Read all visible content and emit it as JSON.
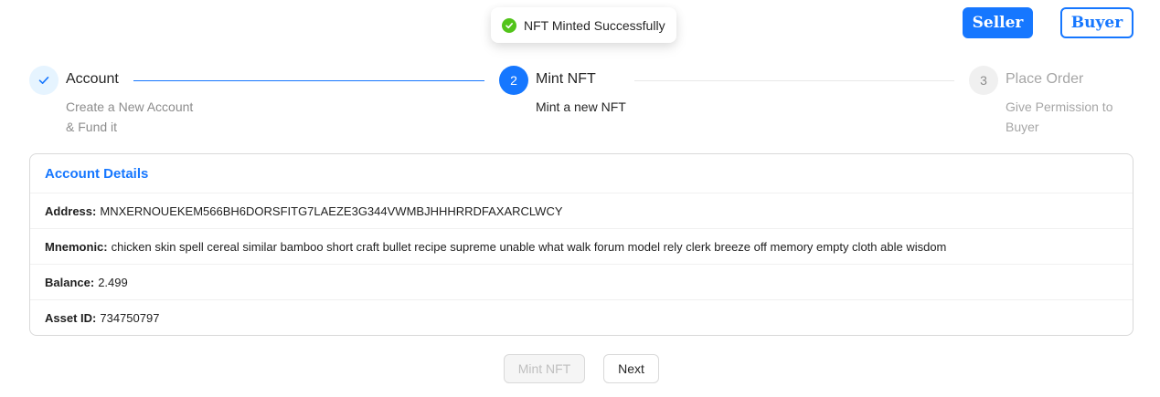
{
  "toast": {
    "message": "NFT Minted Successfully",
    "status_color": "#52c41a"
  },
  "header": {
    "seller_label": "Seller",
    "buyer_label": "Buyer",
    "accent_color": "#1677ff"
  },
  "steps": [
    {
      "number": "1",
      "title": "Account",
      "description": "Create a New Account & Fund it",
      "status": "finished",
      "icon": "check-icon"
    },
    {
      "number": "2",
      "title": "Mint NFT",
      "description": "Mint a new NFT",
      "status": "current"
    },
    {
      "number": "3",
      "title": "Place Order",
      "description": "Give Permission to Buyer",
      "status": "waiting"
    }
  ],
  "account_details": {
    "title": "Account Details",
    "address_label": "Address:",
    "address_value": "MNXERNOUEKEM566BH6DORSFITG7LAEZE3G344VWMBJHHHRRDFAXARCLWCY",
    "mnemonic_label": "Mnemonic:",
    "mnemonic_value": "chicken skin spell cereal similar bamboo short craft bullet recipe supreme unable what walk forum model rely clerk breeze off memory empty cloth able wisdom",
    "balance_label": "Balance:",
    "balance_value": "2.499",
    "asset_label": "Asset ID:",
    "asset_value": "734750797"
  },
  "actions": {
    "mint_label": "Mint NFT",
    "mint_disabled": true,
    "next_label": "Next"
  }
}
